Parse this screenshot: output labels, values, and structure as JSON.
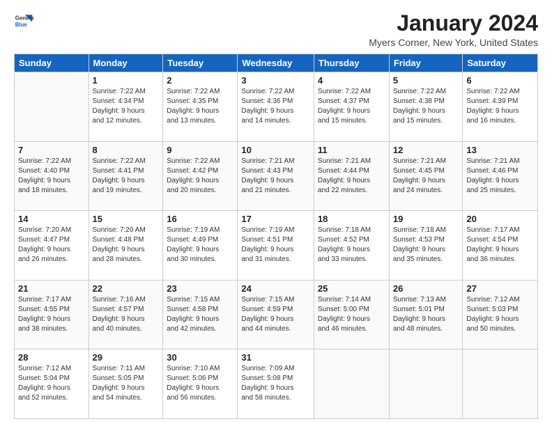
{
  "logo": {
    "general": "General",
    "blue": "Blue"
  },
  "title": "January 2024",
  "location": "Myers Corner, New York, United States",
  "days_header": [
    "Sunday",
    "Monday",
    "Tuesday",
    "Wednesday",
    "Thursday",
    "Friday",
    "Saturday"
  ],
  "weeks": [
    [
      {
        "day": "",
        "info": ""
      },
      {
        "day": "1",
        "info": "Sunrise: 7:22 AM\nSunset: 4:34 PM\nDaylight: 9 hours\nand 12 minutes."
      },
      {
        "day": "2",
        "info": "Sunrise: 7:22 AM\nSunset: 4:35 PM\nDaylight: 9 hours\nand 13 minutes."
      },
      {
        "day": "3",
        "info": "Sunrise: 7:22 AM\nSunset: 4:36 PM\nDaylight: 9 hours\nand 14 minutes."
      },
      {
        "day": "4",
        "info": "Sunrise: 7:22 AM\nSunset: 4:37 PM\nDaylight: 9 hours\nand 15 minutes."
      },
      {
        "day": "5",
        "info": "Sunrise: 7:22 AM\nSunset: 4:38 PM\nDaylight: 9 hours\nand 15 minutes."
      },
      {
        "day": "6",
        "info": "Sunrise: 7:22 AM\nSunset: 4:39 PM\nDaylight: 9 hours\nand 16 minutes."
      }
    ],
    [
      {
        "day": "7",
        "info": "Sunrise: 7:22 AM\nSunset: 4:40 PM\nDaylight: 9 hours\nand 18 minutes."
      },
      {
        "day": "8",
        "info": "Sunrise: 7:22 AM\nSunset: 4:41 PM\nDaylight: 9 hours\nand 19 minutes."
      },
      {
        "day": "9",
        "info": "Sunrise: 7:22 AM\nSunset: 4:42 PM\nDaylight: 9 hours\nand 20 minutes."
      },
      {
        "day": "10",
        "info": "Sunrise: 7:21 AM\nSunset: 4:43 PM\nDaylight: 9 hours\nand 21 minutes."
      },
      {
        "day": "11",
        "info": "Sunrise: 7:21 AM\nSunset: 4:44 PM\nDaylight: 9 hours\nand 22 minutes."
      },
      {
        "day": "12",
        "info": "Sunrise: 7:21 AM\nSunset: 4:45 PM\nDaylight: 9 hours\nand 24 minutes."
      },
      {
        "day": "13",
        "info": "Sunrise: 7:21 AM\nSunset: 4:46 PM\nDaylight: 9 hours\nand 25 minutes."
      }
    ],
    [
      {
        "day": "14",
        "info": "Sunrise: 7:20 AM\nSunset: 4:47 PM\nDaylight: 9 hours\nand 26 minutes."
      },
      {
        "day": "15",
        "info": "Sunrise: 7:20 AM\nSunset: 4:48 PM\nDaylight: 9 hours\nand 28 minutes."
      },
      {
        "day": "16",
        "info": "Sunrise: 7:19 AM\nSunset: 4:49 PM\nDaylight: 9 hours\nand 30 minutes."
      },
      {
        "day": "17",
        "info": "Sunrise: 7:19 AM\nSunset: 4:51 PM\nDaylight: 9 hours\nand 31 minutes."
      },
      {
        "day": "18",
        "info": "Sunrise: 7:18 AM\nSunset: 4:52 PM\nDaylight: 9 hours\nand 33 minutes."
      },
      {
        "day": "19",
        "info": "Sunrise: 7:18 AM\nSunset: 4:53 PM\nDaylight: 9 hours\nand 35 minutes."
      },
      {
        "day": "20",
        "info": "Sunrise: 7:17 AM\nSunset: 4:54 PM\nDaylight: 9 hours\nand 36 minutes."
      }
    ],
    [
      {
        "day": "21",
        "info": "Sunrise: 7:17 AM\nSunset: 4:55 PM\nDaylight: 9 hours\nand 38 minutes."
      },
      {
        "day": "22",
        "info": "Sunrise: 7:16 AM\nSunset: 4:57 PM\nDaylight: 9 hours\nand 40 minutes."
      },
      {
        "day": "23",
        "info": "Sunrise: 7:15 AM\nSunset: 4:58 PM\nDaylight: 9 hours\nand 42 minutes."
      },
      {
        "day": "24",
        "info": "Sunrise: 7:15 AM\nSunset: 4:59 PM\nDaylight: 9 hours\nand 44 minutes."
      },
      {
        "day": "25",
        "info": "Sunrise: 7:14 AM\nSunset: 5:00 PM\nDaylight: 9 hours\nand 46 minutes."
      },
      {
        "day": "26",
        "info": "Sunrise: 7:13 AM\nSunset: 5:01 PM\nDaylight: 9 hours\nand 48 minutes."
      },
      {
        "day": "27",
        "info": "Sunrise: 7:12 AM\nSunset: 5:03 PM\nDaylight: 9 hours\nand 50 minutes."
      }
    ],
    [
      {
        "day": "28",
        "info": "Sunrise: 7:12 AM\nSunset: 5:04 PM\nDaylight: 9 hours\nand 52 minutes."
      },
      {
        "day": "29",
        "info": "Sunrise: 7:11 AM\nSunset: 5:05 PM\nDaylight: 9 hours\nand 54 minutes."
      },
      {
        "day": "30",
        "info": "Sunrise: 7:10 AM\nSunset: 5:06 PM\nDaylight: 9 hours\nand 56 minutes."
      },
      {
        "day": "31",
        "info": "Sunrise: 7:09 AM\nSunset: 5:08 PM\nDaylight: 9 hours\nand 58 minutes."
      },
      {
        "day": "",
        "info": ""
      },
      {
        "day": "",
        "info": ""
      },
      {
        "day": "",
        "info": ""
      }
    ]
  ]
}
